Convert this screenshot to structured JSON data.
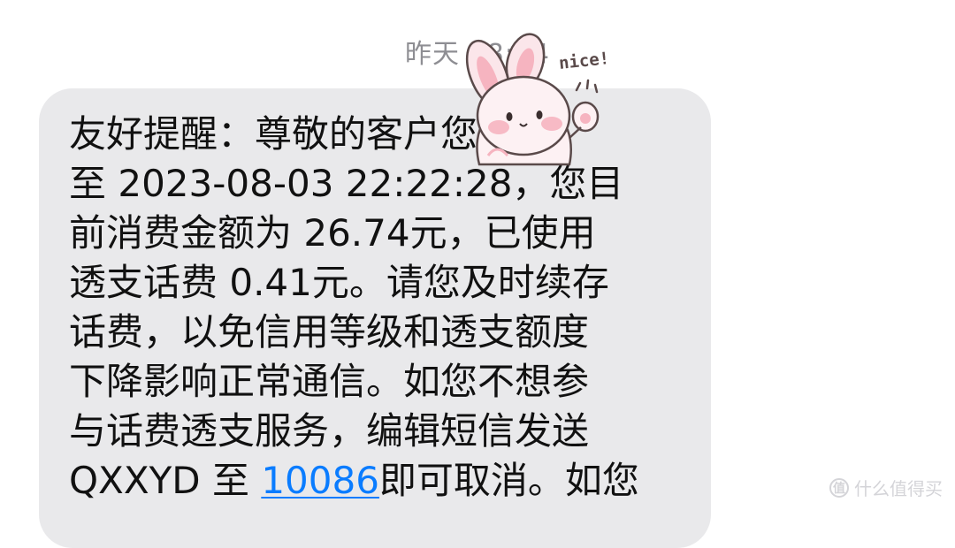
{
  "timestamp": "昨天 08:54",
  "message": {
    "line1": "友好提醒：尊敬的客户您，截",
    "line2": "至 2023-08-03 22:22:28，您目",
    "line3": "前消费金额为 26.74元，已使用",
    "line4": "透支话费 0.41元。请您及时续存",
    "line5": "话费，以免信用等级和透支额度",
    "line6": "下降影响正常通信。如您不想参",
    "line7": "与话费透支服务，编辑短信发送",
    "line8_prefix": "QXXYD 至 ",
    "line8_link": "10086",
    "line8_suffix": "即可取消。如您"
  },
  "sticker": {
    "label": "nice!",
    "icon": "bunny-sticker-icon"
  },
  "watermark": {
    "icon_char": "值",
    "text": "什么值得买"
  },
  "colors": {
    "bubble": "#e9e9eb",
    "link": "#0a7cff",
    "timestamp": "#8e8e93"
  }
}
